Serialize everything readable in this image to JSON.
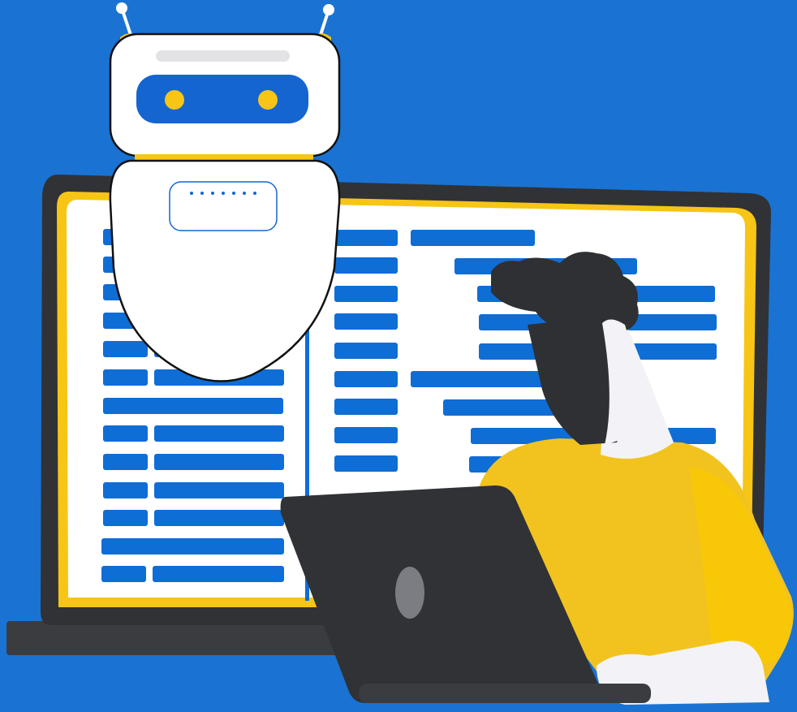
{
  "scene": {
    "subject": "robot-and-developer-illustration"
  },
  "colors": {
    "background": "#1A73D2",
    "code_bar": "#0F6DD6",
    "screen": "#FFFFFF",
    "bezel": "#303236",
    "accent_yellow": "#F6C516",
    "sweater": "#F2C31F",
    "hair": "#2E3033",
    "skin": "#F3F3F7",
    "laptop": "#303236",
    "robot_visor": "#1565D0"
  },
  "icons": [
    "robot-icon",
    "monitor-icon",
    "laptop-icon",
    "developer-figure-icon"
  ],
  "text": {}
}
